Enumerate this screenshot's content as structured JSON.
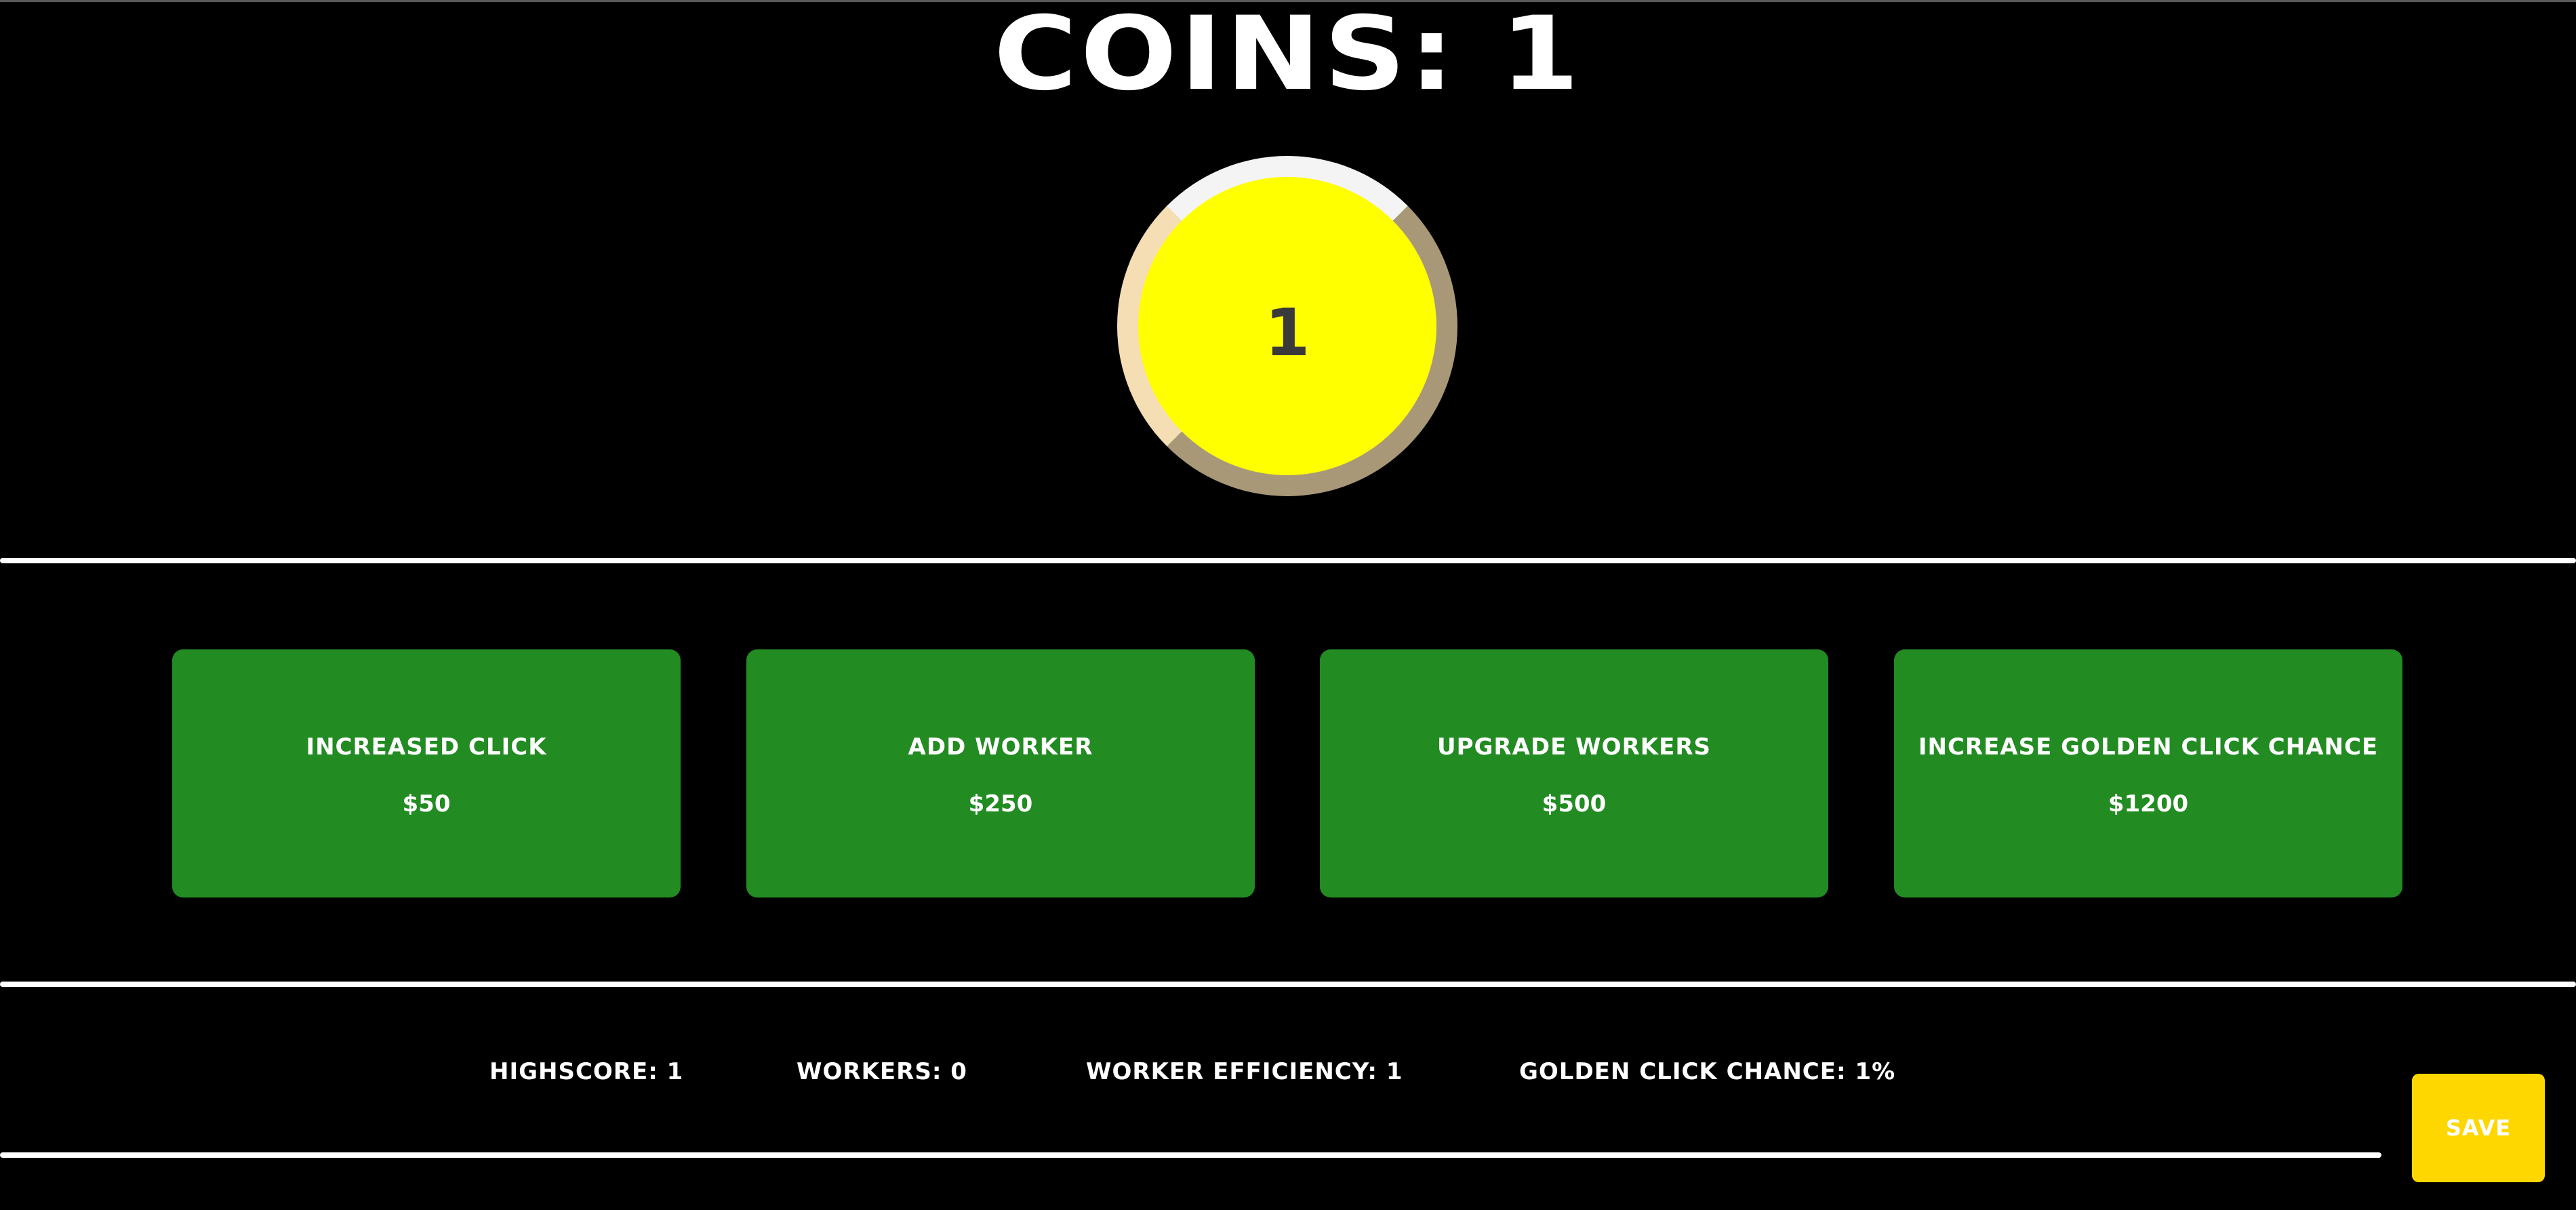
{
  "header": {
    "coins_label": "COINS: 1"
  },
  "coin": {
    "value": "1",
    "face_color": "#ffff00"
  },
  "shop": {
    "items": [
      {
        "label": "INCREASED CLICK",
        "price": "$50"
      },
      {
        "label": "ADD WORKER",
        "price": "$250"
      },
      {
        "label": "UPGRADE WORKERS",
        "price": "$500"
      },
      {
        "label": "INCREASE GOLDEN CLICK CHANCE",
        "price": "$1200"
      }
    ],
    "button_color": "#228b22"
  },
  "stats": {
    "highscore": "HIGHSCORE: 1",
    "workers": "WORKERS: 0",
    "worker_efficiency": "WORKER EFFICIENCY: 1",
    "golden_click_chance": "GOLDEN CLICK CHANCE: 1%"
  },
  "save": {
    "label": "SAVE",
    "color": "#ffd700"
  }
}
